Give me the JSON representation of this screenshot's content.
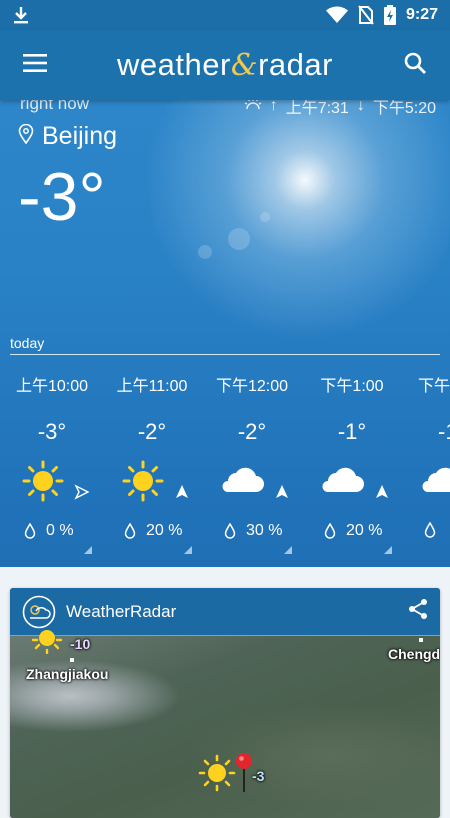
{
  "status_bar": {
    "time": "9:27"
  },
  "app_bar": {
    "brand_part1": "weather",
    "brand_amp": "&",
    "brand_part2": "radar"
  },
  "current": {
    "label": "right now",
    "sunrise": "上午7:31",
    "sunset": "下午5:20",
    "city": "Beijing",
    "temperature": "-3°"
  },
  "forecast": {
    "label": "today",
    "hours": [
      {
        "time": "上午10:00",
        "temp": "-3°",
        "icon": "sun-icon",
        "precip": "0 %"
      },
      {
        "time": "上午11:00",
        "temp": "-2°",
        "icon": "sun-icon",
        "precip": "20 %"
      },
      {
        "time": "下午12:00",
        "temp": "-2°",
        "icon": "cloud-icon",
        "precip": "30 %"
      },
      {
        "time": "下午1:00",
        "temp": "-1°",
        "icon": "cloud-icon",
        "precip": "20 %"
      },
      {
        "time": "下午",
        "temp": "-1",
        "icon": "cloud-icon",
        "precip": ""
      }
    ]
  },
  "radar_card": {
    "title": "WeatherRadar",
    "map_labels": {
      "city_1": "Zhangjiakou",
      "city_2": "Chengd",
      "temp_1": "-10",
      "temp_2": "-3"
    }
  },
  "colors": {
    "app_bar": "#1c72ad",
    "status_bar": "#1b6ea8",
    "brand_accent": "#f2c94c",
    "sun": "#ffd21f",
    "marker": "#e3262b"
  }
}
